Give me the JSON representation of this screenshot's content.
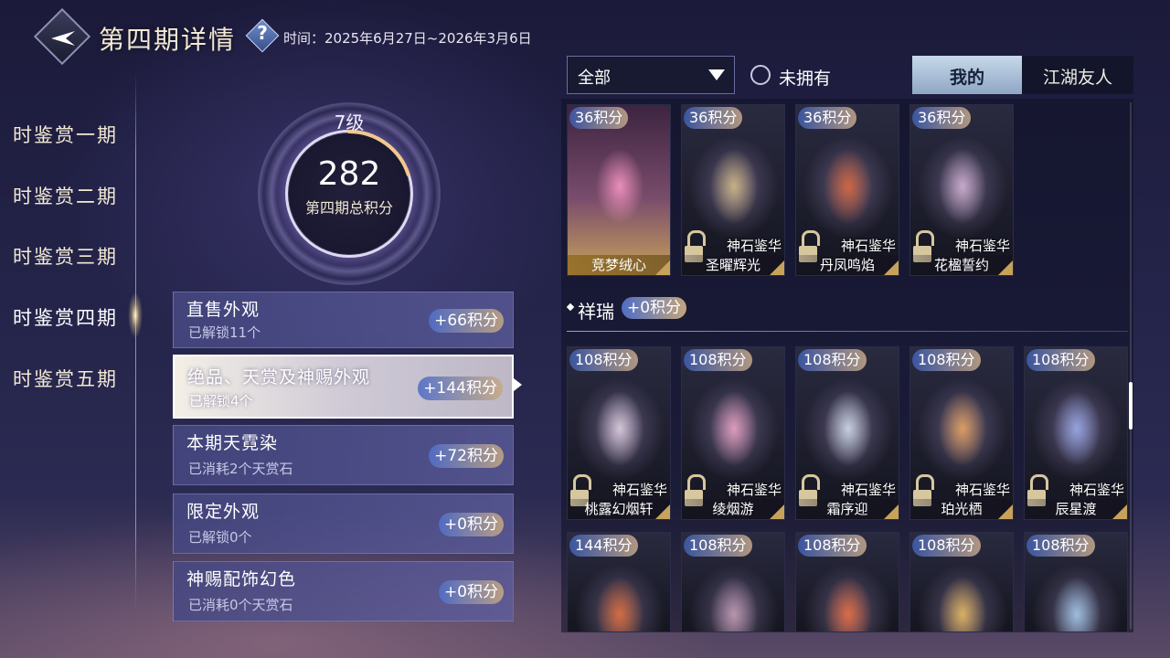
{
  "header": {
    "title": "第四期详情",
    "help": "?",
    "period": "时间：2025年6月27日~2026年3月6日"
  },
  "nav": {
    "items": [
      "时鉴赏一期",
      "时鉴赏二期",
      "时鉴赏三期",
      "时鉴赏四期",
      "时鉴赏五期"
    ],
    "selected_index": 3
  },
  "progress": {
    "level": "7级",
    "score": "282",
    "label": "第四期总积分",
    "level_fill_fraction": 0.2
  },
  "categories": [
    {
      "title": "直售外观",
      "sub": "已解锁11个",
      "points": "+66积分"
    },
    {
      "title": "绝品、天赏及神赐外观",
      "sub": "已解锁4个",
      "points": "+144积分",
      "selected": true
    },
    {
      "title": "本期天霓染",
      "sub": "已消耗2个天赏石",
      "points": "+72积分"
    },
    {
      "title": "限定外观",
      "sub": "已解锁0个",
      "points": "+0积分"
    },
    {
      "title": "神赐配饰幻色",
      "sub": "已消耗0个天赏石",
      "points": "+0积分"
    }
  ],
  "filters": {
    "dropdown": "全部",
    "unowned": "未拥有",
    "tab_mine": "我的",
    "tab_friends": "江湖友人"
  },
  "top_cards": [
    {
      "points": "36积分",
      "name": "竞梦绒心",
      "source": "",
      "owned": true,
      "tint": "#ff9cc8"
    },
    {
      "points": "36积分",
      "name": "圣曜辉光",
      "source": "神石鉴华",
      "owned": false,
      "tint": "#d9c08a"
    },
    {
      "points": "36积分",
      "name": "丹凤鸣焰",
      "source": "神石鉴华",
      "owned": false,
      "tint": "#e2683a"
    },
    {
      "points": "36积分",
      "name": "花楹誓约",
      "source": "神石鉴华",
      "owned": false,
      "tint": "#d8b8d8"
    }
  ],
  "section": {
    "title": "祥瑞",
    "points": "+0积分"
  },
  "section_cards": [
    {
      "points": "108积分",
      "name": "桃露幻烟轩",
      "source": "神石鉴华",
      "tint": "#e8d8e8"
    },
    {
      "points": "108积分",
      "name": "绫烟游",
      "source": "神石鉴华",
      "tint": "#f2a8c8"
    },
    {
      "points": "108积分",
      "name": "霜序迎",
      "source": "神石鉴华",
      "tint": "#d8e4f0"
    },
    {
      "points": "108积分",
      "name": "珀光栖",
      "source": "神石鉴华",
      "tint": "#f0a860"
    },
    {
      "points": "108积分",
      "name": "辰星渡",
      "source": "神石鉴华",
      "tint": "#9fb0f0"
    }
  ],
  "bottom_cards": [
    {
      "points": "144积分",
      "tint": "#e87038"
    },
    {
      "points": "108积分",
      "tint": "#c8a0b8"
    },
    {
      "points": "108积分",
      "tint": "#f07040"
    },
    {
      "points": "108积分",
      "tint": "#f0c060"
    },
    {
      "points": "108积分",
      "tint": "#a8d0f0"
    }
  ]
}
